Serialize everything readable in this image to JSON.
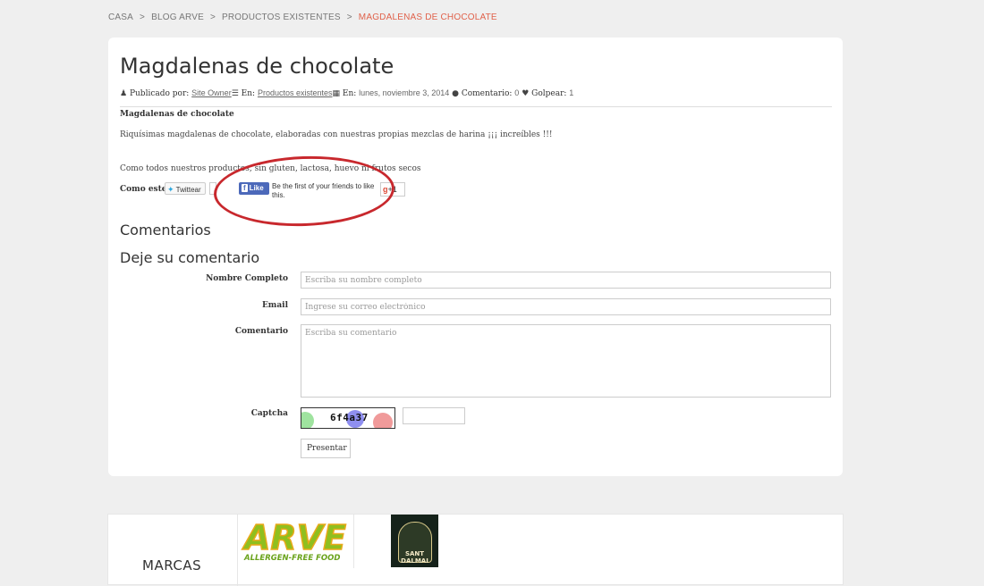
{
  "breadcrumb": {
    "items": [
      "CASA",
      "BLOG ARVE",
      "PRODUCTOS EXISTENTES"
    ],
    "separator": ">",
    "current": "MAGDALENAS DE CHOCOLATE"
  },
  "post": {
    "title": "Magdalenas de chocolate",
    "meta": {
      "published_label": "Publicado por:",
      "author": "Site Owner",
      "category_label": "En:",
      "category": "Productos existentes",
      "date_label": "En:",
      "date": "lunes, noviembre 3, 2014",
      "comments_label": "Comentario:",
      "comments_count": "0",
      "likes_label": "Golpear:",
      "likes_count": "1"
    },
    "heading": "Magdalenas de chocolate",
    "paragraph1": "Riquísimas magdalenas de chocolate, elaboradas con nuestras propias mezclas de harina ¡¡¡ increíbles !!!",
    "paragraph2": "Como todos nuestros productos, sin gluten, lactosa, huevo ni frutos secos"
  },
  "share": {
    "label": "Como este",
    "twitter_label": "Twittear",
    "facebook_label": "Like",
    "facebook_text": "Be the first of your friends to like this.",
    "gplus_label": "+1"
  },
  "comments": {
    "heading": "Comentarios",
    "form_heading": "Deje su comentario",
    "name_label": "Nombre Completo",
    "name_placeholder": "Escriba su nombre completo",
    "email_label": "Email",
    "email_placeholder": "Ingrese su correo electrónico",
    "comment_label": "Comentario",
    "comment_placeholder": "Escriba su comentario",
    "captcha_label": "Captcha",
    "captcha_text": "6f4a37",
    "submit_label": "Presentar"
  },
  "brands": {
    "label": "MARCAS",
    "arve_name": "ARVE",
    "arve_tagline": "ALLERGEN-FREE FOOD",
    "sant_line1": "SANT",
    "sant_line2": "DALMAI"
  },
  "colors": {
    "accent": "#e0614a",
    "annotation_red": "#c8282d",
    "facebook_blue": "#4c69ba"
  }
}
